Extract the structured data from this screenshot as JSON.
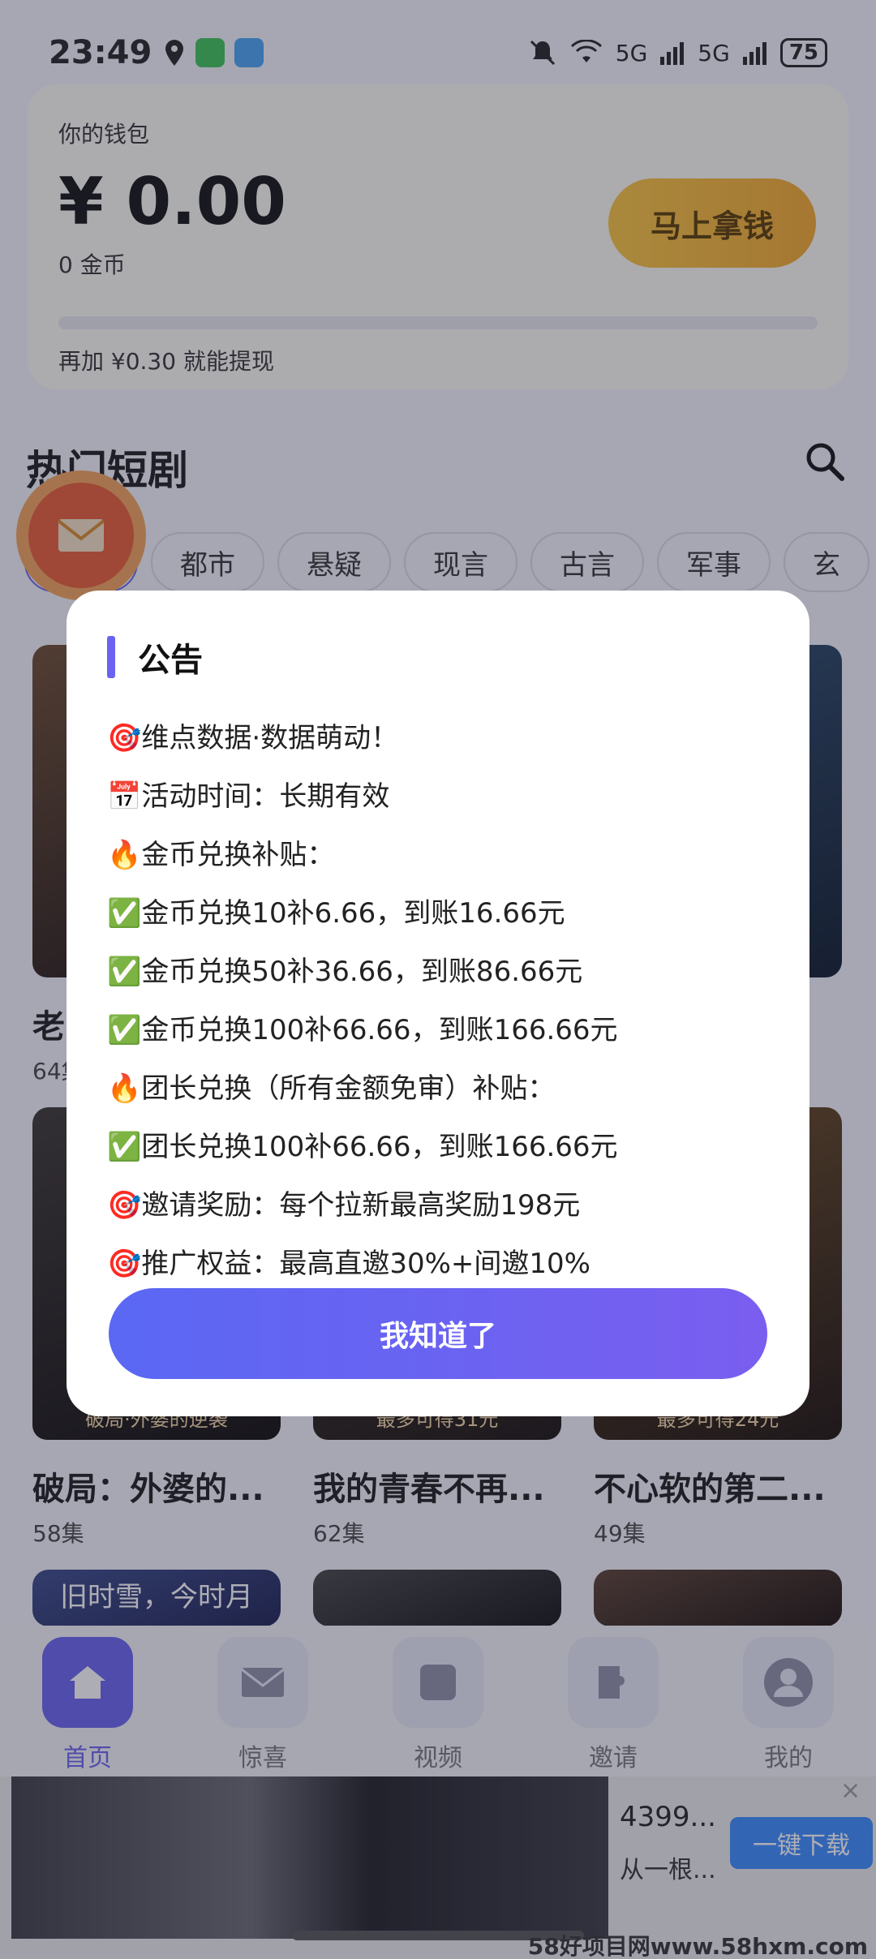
{
  "status_bar": {
    "time": "23:49",
    "network_1": "5G",
    "network_2": "5G",
    "battery": "75"
  },
  "wallet": {
    "title": "你的钱包",
    "amount": "¥ 0.00",
    "coins": "0 金币",
    "tip": "再加 ¥0.30 就能提现",
    "button": "马上拿钱"
  },
  "section": {
    "title": "热门短剧"
  },
  "categories": [
    "",
    "都市",
    "悬疑",
    "现言",
    "古言",
    "军事",
    "玄"
  ],
  "dramas": [
    {
      "title": "老",
      "episodes": "64集",
      "caption": ""
    },
    {
      "title": "破局：外婆的...",
      "episodes": "58集",
      "caption": "破局·外婆的逆袭"
    },
    {
      "title": "我的青春不再...",
      "episodes": "62集",
      "caption": "最多可得31元"
    },
    {
      "title": "不心软的第二...",
      "episodes": "49集",
      "caption": "最多可得24元"
    },
    {
      "title": "",
      "episodes": "",
      "caption": "旧时雪，今时月"
    }
  ],
  "bottom_nav": [
    {
      "label": "首页",
      "icon": "home-icon"
    },
    {
      "label": "惊喜",
      "icon": "mail-icon"
    },
    {
      "label": "视频",
      "icon": "video-icon"
    },
    {
      "label": "邀请",
      "icon": "invite-icon"
    },
    {
      "label": "我的",
      "icon": "profile-icon"
    }
  ],
  "ad": {
    "title": "4399...",
    "desc": "从一根...",
    "button": "一键下载",
    "close": "×"
  },
  "watermark": "58好项目网www.58hxm.com",
  "dialog": {
    "title": "公告",
    "lines": [
      "🎯维点数据·数据萌动！",
      "📅活动时间：长期有效",
      "🔥金币兑换补贴：",
      "✅金币兑换10补6.66，到账16.66元",
      "✅金币兑换50补36.66，到账86.66元",
      "✅金币兑换100补66.66，到账166.66元",
      "🔥团长兑换（所有金额免审）补贴：",
      "✅团长兑换100补66.66，到账166.66元",
      "🎯邀请奖励：每个拉新最高奖励198元",
      "🎯推广权益：最高直邀30%+间邀10%"
    ],
    "button": "我知道了"
  },
  "colors": {
    "accent": "#6a63ef",
    "gold": "#f4a92c",
    "ad_button": "#3b8cff"
  }
}
